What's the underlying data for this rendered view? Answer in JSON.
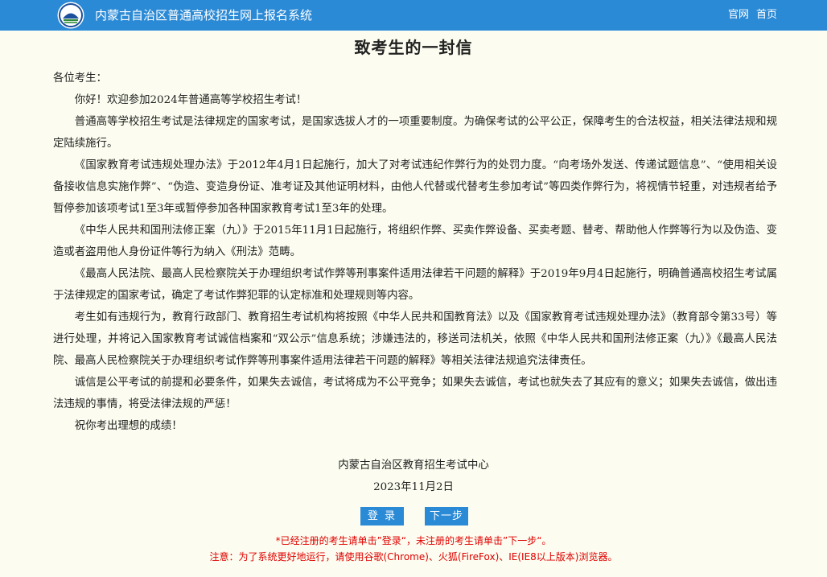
{
  "header": {
    "logo_icon": "education-exam-logo-icon",
    "title": "内蒙古自治区普通高校招生网上报名系统",
    "nav": [
      "官网",
      "首页"
    ],
    "background_color": "#2b8ad6"
  },
  "letter": {
    "title": "致考生的一封信",
    "salutation": "各位考生：",
    "paragraphs": [
      "你好！欢迎参加2024年普通高等学校招生考试！",
      "普通高等学校招生考试是法律规定的国家考试，是国家选拔人才的一项重要制度。为确保考试的公平公正，保障考生的合法权益，相关法律法规和规定陆续施行。",
      "《国家教育考试违规处理办法》于2012年4月1日起施行，加大了对考试违纪作弊行为的处罚力度。“向考场外发送、传递试题信息”、“使用相关设备接收信息实施作弊”、“伪造、变造身份证、准考证及其他证明材料，由他人代替或代替考生参加考试”等四类作弊行为，将视情节轻重，对违规者给予暂停参加该项考试1至3年或暂停参加各种国家教育考试1至3年的处理。",
      "《中华人民共和国刑法修正案（九）》于2015年11月1日起施行，将组织作弊、买卖作弊设备、买卖考题、替考、帮助他人作弊等行为以及伪造、变造或者盗用他人身份证件等行为纳入《刑法》范畴。",
      "《最高人民法院、最高人民检察院关于办理组织考试作弊等刑事案件适用法律若干问题的解释》于2019年9月4日起施行，明确普通高校招生考试属于法律规定的国家考试，确定了考试作弊犯罪的认定标准和处理规则等内容。",
      "考生如有违规行为，教育行政部门、教育招生考试机构将按照《中华人民共和国教育法》以及《国家教育考试违规处理办法》（教育部令第33号）等进行处理，并将记入国家教育考试诚信档案和“双公示”信息系统；涉嫌违法的，移送司法机关，依照《中华人民共和国刑法修正案（九）》《最高人民法院、最高人民检察院关于办理组织考试作弊等刑事案件适用法律若干问题的解释》等相关法律法规追究法律责任。",
      "诚信是公平考试的前提和必要条件，如果失去诚信，考试将成为不公平竞争；如果失去诚信，考试也就失去了其应有的意义；如果失去诚信，做出违法违规的事情，将受法律法规的严惩！",
      "祝你考出理想的成绩！"
    ],
    "signature_org": "内蒙古自治区教育招生考试中心",
    "signature_date": "2023年11月2日"
  },
  "actions": {
    "login_label": "登 录",
    "next_label": "下一步"
  },
  "notices": {
    "line1": "*已经注册的考生请单击”登录“，未注册的考生请单击”下一步“。",
    "line2": "注意：为了系统更好地运行，请使用谷歌(Chrome)、火狐(FireFox)、IE(IE8以上版本)浏览器。",
    "color": "#e00000"
  }
}
